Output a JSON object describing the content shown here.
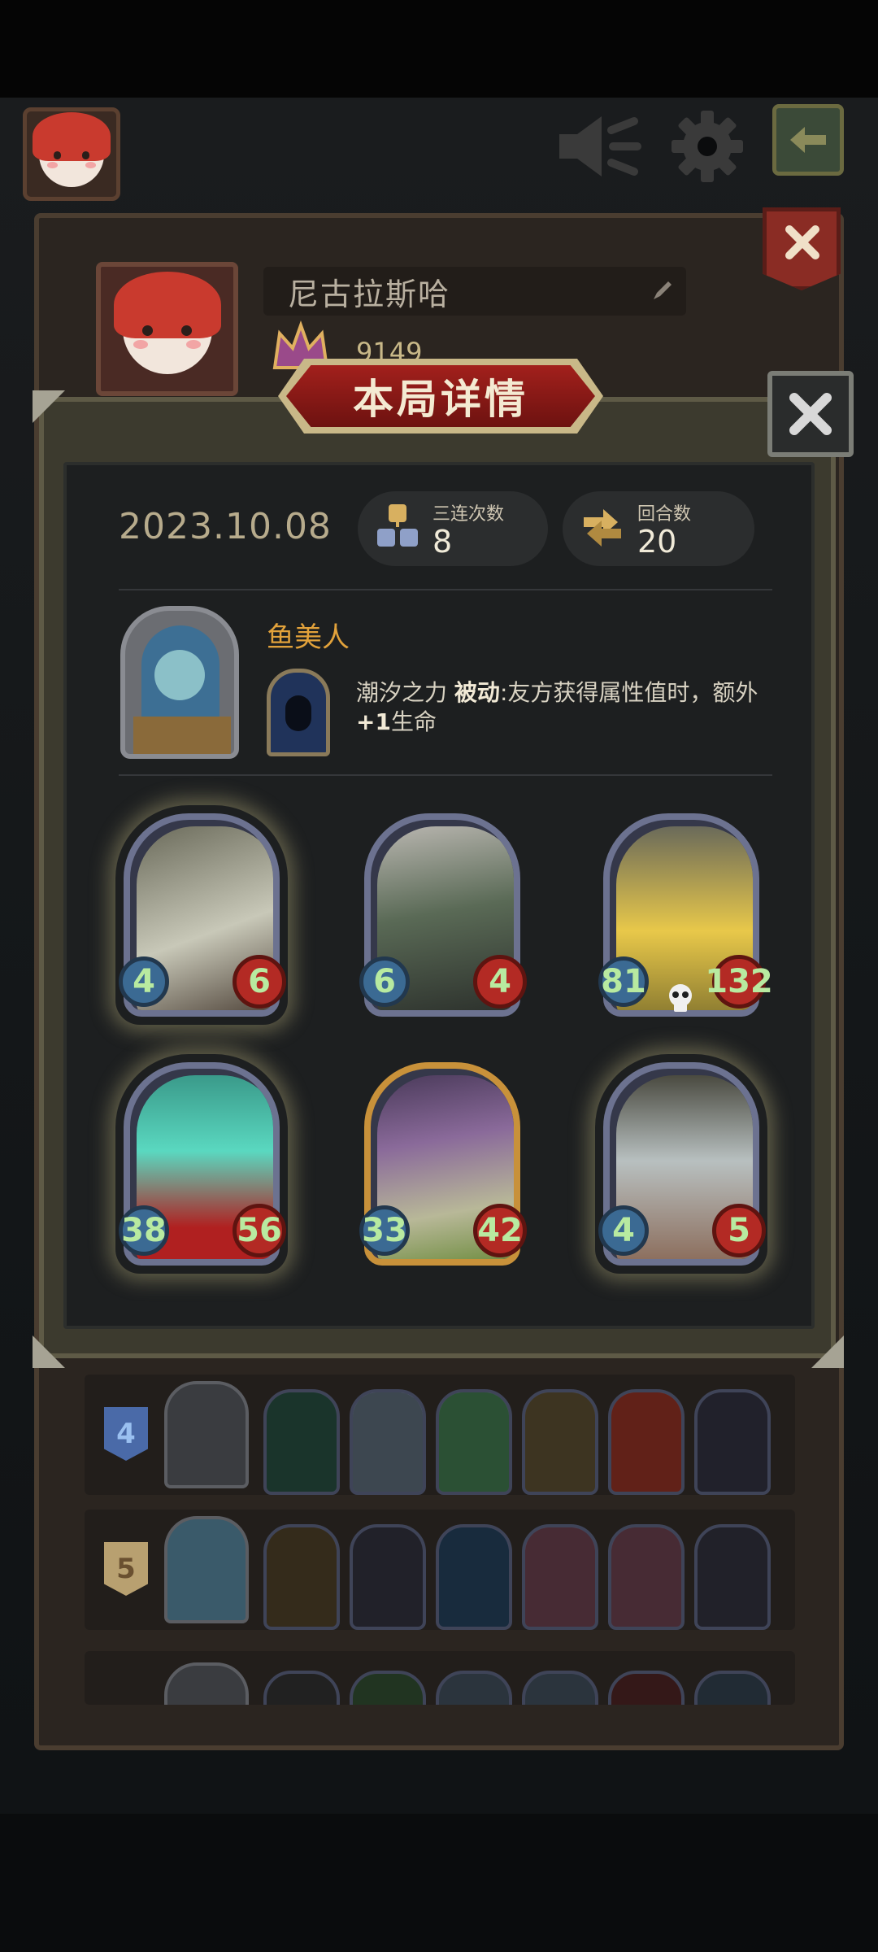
{
  "top_bar": {
    "avatar_icon": "player-avatar",
    "speaker_icon": "speaker-icon",
    "settings_icon": "gear-icon",
    "back_icon": "back-arrow-icon"
  },
  "profile": {
    "player_name": "尼古拉斯哈",
    "score": "9149"
  },
  "modal": {
    "title": "本局详情",
    "date": "2023.10.08",
    "stats": [
      {
        "label": "三连次数",
        "value": "8",
        "icon": "triple-merge-icon"
      },
      {
        "label": "回合数",
        "value": "20",
        "icon": "rounds-icon"
      }
    ],
    "hero": {
      "name": "鱼美人",
      "skill_name": "潮汐之力",
      "skill_type": "被动",
      "skill_desc": ":友方获得属性值时，额外",
      "skill_desc_bold": "+1",
      "skill_desc_tail": "生命"
    },
    "cards": [
      {
        "attack": "4",
        "health": "6",
        "frame": "silver",
        "glow": true,
        "art": "dragon"
      },
      {
        "attack": "6",
        "health": "4",
        "frame": "silver",
        "glow": false,
        "art": "necromancer"
      },
      {
        "attack": "81",
        "health": "132",
        "frame": "silver",
        "glow": false,
        "art": "golem",
        "death_icon": true
      },
      {
        "attack": "38",
        "health": "56",
        "frame": "silver",
        "glow": true,
        "art": "spirit"
      },
      {
        "attack": "33",
        "health": "42",
        "frame": "gold",
        "glow": false,
        "art": "serpent"
      },
      {
        "attack": "4",
        "health": "5",
        "frame": "silver",
        "glow": true,
        "art": "beast"
      }
    ]
  },
  "lineups": [
    {
      "rank": "4",
      "badge_color": "#4a6aa8"
    },
    {
      "rank": "5",
      "badge_color": "#b8a070"
    }
  ],
  "colors": {
    "accent_red": "#a2201c",
    "hero_name": "#e2a23b",
    "stat_green": "#b8eaa0"
  }
}
